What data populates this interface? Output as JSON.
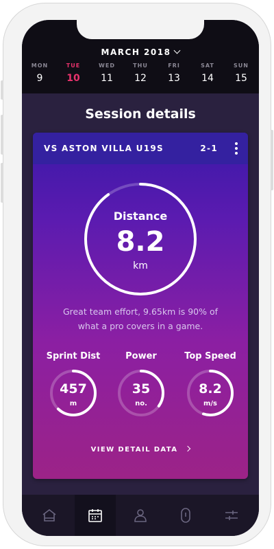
{
  "calendar": {
    "month_label": "MARCH 2018",
    "days": [
      {
        "name": "MON",
        "date": "9"
      },
      {
        "name": "TUE",
        "date": "10"
      },
      {
        "name": "WED",
        "date": "11"
      },
      {
        "name": "THU",
        "date": "12"
      },
      {
        "name": "FRI",
        "date": "13"
      },
      {
        "name": "SAT",
        "date": "14"
      },
      {
        "name": "SUN",
        "date": "15"
      }
    ],
    "selected_day": "TUE"
  },
  "page": {
    "title": "Session details"
  },
  "session": {
    "opponent": "VS ASTON VILLA U19S",
    "score": "2-1",
    "distance": {
      "label": "Distance",
      "value": "8.2",
      "unit": "km",
      "progress": 0.9
    },
    "message": "Great team effort, 9.65km is 90% of what a pro covers in a game.",
    "stats": [
      {
        "label": "Sprint Dist",
        "value": "457",
        "unit": "m",
        "progress": 0.62
      },
      {
        "label": "Power",
        "value": "35",
        "unit": "no.",
        "progress": 0.35
      },
      {
        "label": "Top Speed",
        "value": "8.2",
        "unit": "m/s",
        "progress": 0.55
      }
    ],
    "detail_link": "VIEW DETAIL DATA"
  },
  "tabbar": {
    "items": [
      {
        "icon": "home-icon"
      },
      {
        "icon": "calendar-icon",
        "active": true
      },
      {
        "icon": "profile-icon"
      },
      {
        "icon": "device-icon"
      },
      {
        "icon": "settings-sliders-icon"
      }
    ]
  },
  "colors": {
    "accent": "#e8326c",
    "card_top": "#3a18a8",
    "card_bottom": "#9c2387",
    "background": "#2a213f"
  }
}
